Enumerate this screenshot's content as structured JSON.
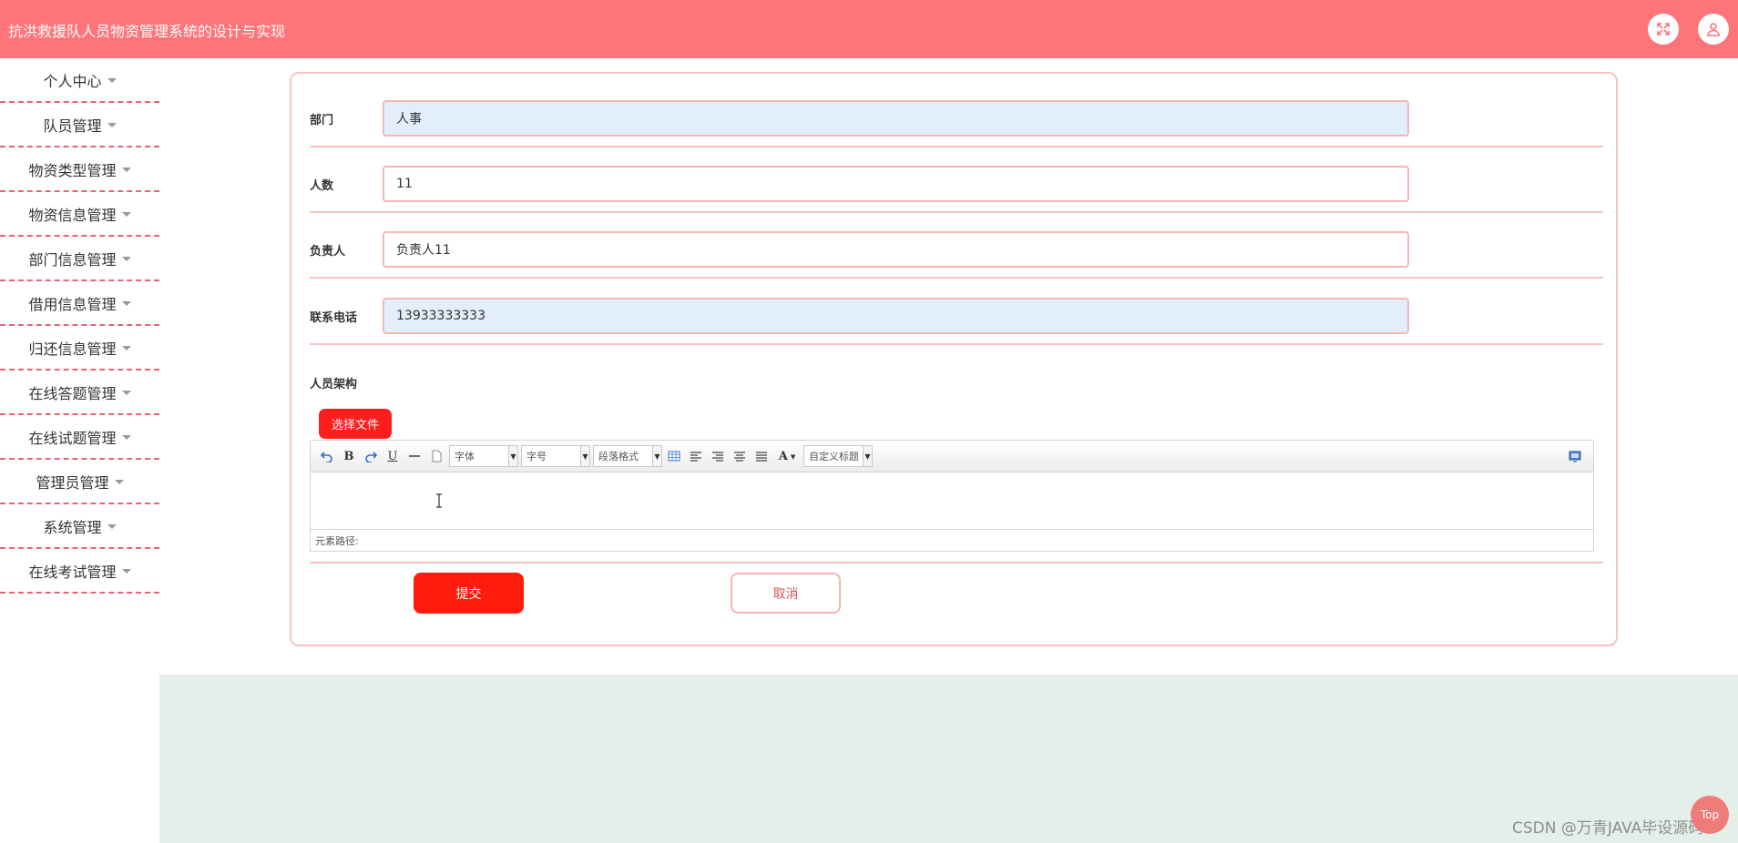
{
  "app": {
    "title": "抗洪救援队人员物资管理系统的设计与实现"
  },
  "header_icons": [
    "fullscreen-icon",
    "user-icon"
  ],
  "sidebar": {
    "items": [
      {
        "label": "个人中心"
      },
      {
        "label": "队员管理"
      },
      {
        "label": "物资类型管理"
      },
      {
        "label": "物资信息管理"
      },
      {
        "label": "部门信息管理"
      },
      {
        "label": "借用信息管理"
      },
      {
        "label": "归还信息管理"
      },
      {
        "label": "在线答题管理"
      },
      {
        "label": "在线试题管理"
      },
      {
        "label": "管理员管理"
      },
      {
        "label": "系统管理"
      },
      {
        "label": "在线考试管理"
      }
    ]
  },
  "form": {
    "department": {
      "label": "部门",
      "value": "人事"
    },
    "count": {
      "label": "人数",
      "value": "11"
    },
    "leader": {
      "label": "负责人",
      "value": "负责人11"
    },
    "phone": {
      "label": "联系电话",
      "value": "13933333333"
    },
    "structure": {
      "label": "人员架构"
    },
    "upload_label": "选择文件",
    "submit_label": "提交",
    "cancel_label": "取消"
  },
  "editor": {
    "font_family": "字体",
    "font_size": "字号",
    "paragraph": "段落格式",
    "custom_title": "自定义标题",
    "path_label": "元素路径:",
    "text_color_glyph": "A"
  },
  "colors": {
    "header": "#ff7479",
    "primary_button": "#ff1c0c",
    "border_pink": "#f8c4c2",
    "sidebar_divider": "#e8627a",
    "footer_area": "#e5efe9"
  },
  "footer": {
    "watermark": "CSDN @万青JAVA毕设源码",
    "float_button": "Top"
  }
}
